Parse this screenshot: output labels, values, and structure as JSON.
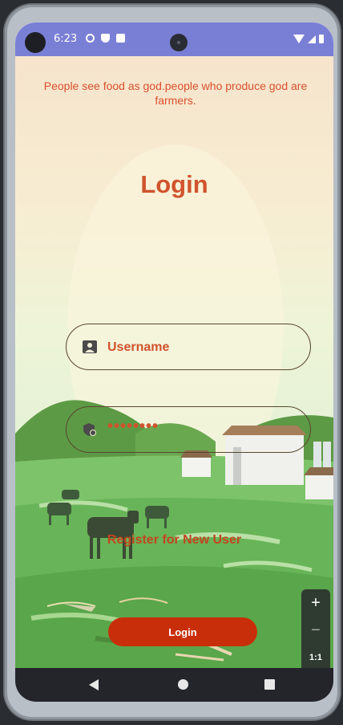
{
  "status_bar": {
    "time": "6:23"
  },
  "app": {
    "quote": "People see food as god.people who produce god are farmers.",
    "title": "Login",
    "username_placeholder": "Username",
    "password_value": "••••••••",
    "register_link": "Register for New User",
    "login_button": "Login"
  },
  "zoom_controls": {
    "zoom_in": "+",
    "zoom_out": "−",
    "reset": "1:1"
  },
  "colors": {
    "accent": "#d0532c",
    "button": "#c92e0a",
    "status_bar": "#7a7fd6"
  },
  "icons": [
    "settings-icon",
    "shield-icon",
    "sd-card-icon",
    "wifi-icon",
    "signal-icon",
    "battery-icon",
    "user-icon",
    "lock-icon",
    "back-icon",
    "home-icon",
    "recents-icon"
  ]
}
